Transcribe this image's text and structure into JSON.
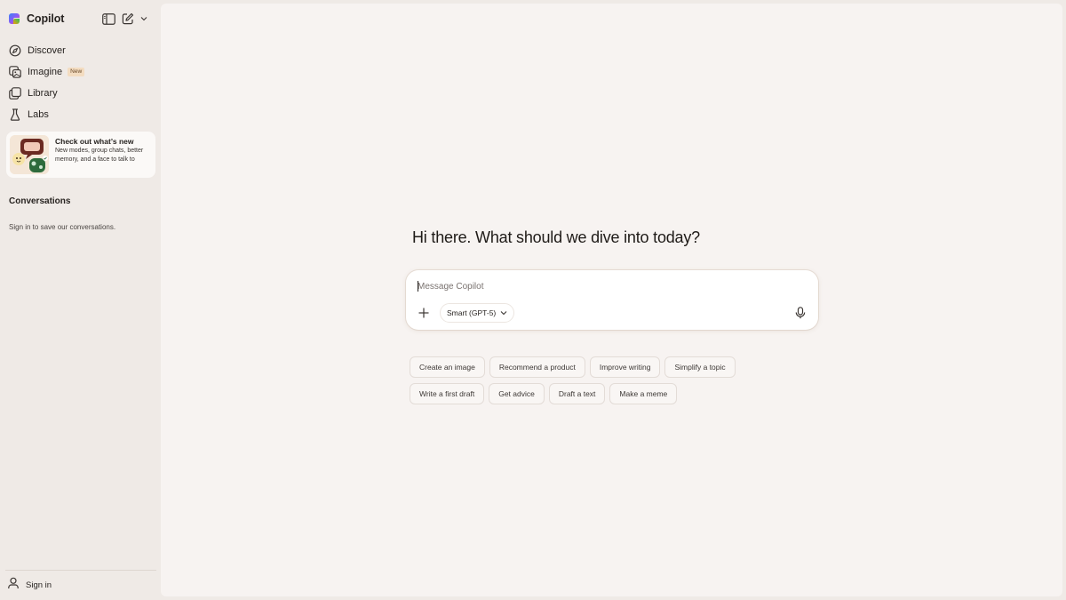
{
  "app": {
    "name": "Copilot"
  },
  "sidebar": {
    "nav": [
      {
        "label": "Discover",
        "icon": "compass-icon"
      },
      {
        "label": "Imagine",
        "icon": "image-sparkle-icon",
        "badge": "New"
      },
      {
        "label": "Library",
        "icon": "library-icon"
      },
      {
        "label": "Labs",
        "icon": "flask-icon"
      }
    ],
    "promo": {
      "title": "Check out what’s new",
      "description": "New modes, group chats, better memory, and a face to talk to"
    },
    "conversations_title": "Conversations",
    "conversations_hint": "Sign in to save our conversations.",
    "sign_in": "Sign in"
  },
  "main": {
    "greeting": "Hi there. What should we dive into today?",
    "composer": {
      "placeholder": "Message Copilot",
      "value": "",
      "model": "Smart (GPT-5)"
    },
    "suggestions_row1": [
      "Create an image",
      "Recommend a product",
      "Improve writing",
      "Simplify a topic"
    ],
    "suggestions_row2": [
      "Write a first draft",
      "Get advice",
      "Draft a text",
      "Make a meme"
    ]
  },
  "colors": {
    "sidebar_bg": "#efeae6",
    "main_bg": "#f7f3f1",
    "text": "#272320",
    "badge_bg": "#f3dcc0"
  }
}
